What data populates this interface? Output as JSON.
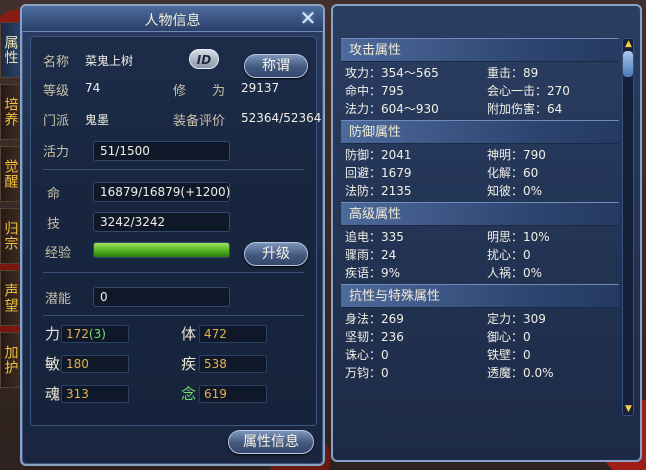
{
  "window": {
    "title": "人物信息"
  },
  "tabs": [
    "属性",
    "培养",
    "觉醒",
    "归宗",
    "声望",
    "加护"
  ],
  "character": {
    "name_label": "名称",
    "name": "菜鬼上树",
    "id_badge": "ID",
    "title_button": "称谓",
    "level_label": "等级",
    "level": "74",
    "cultivation_label": "修　　为",
    "cultivation": "29137",
    "sect_label": "门派",
    "sect": "鬼墨",
    "equip_label": "装备评价",
    "equip": "52364/52364",
    "vitality_label": "活力",
    "vitality": "51/1500",
    "hp_label": "命",
    "hp": "16879/16879(+1200)",
    "skill_label": "技",
    "skill": "3242/3242",
    "exp_label": "经验",
    "exp_fraction": 1.0,
    "levelup_button": "升级",
    "potential_label": "潜能",
    "potential": "0"
  },
  "stats": {
    "str_label": "力",
    "str": "172",
    "str_bonus": "(3)",
    "con_label": "体",
    "con": "472",
    "agi_label": "敏",
    "agi": "180",
    "spd_label": "疾",
    "spd": "538",
    "soul_label": "魂",
    "soul": "313",
    "mind_label": "念",
    "mind": "619"
  },
  "attr_info_button": "属性信息",
  "attributes": {
    "sections": [
      {
        "title": "攻击属性",
        "rows": [
          [
            "攻力：354～565",
            "重击：89"
          ],
          [
            "命中：795",
            "会心一击：270"
          ],
          [
            "法力：604～930",
            "附加伤害：64"
          ]
        ]
      },
      {
        "title": "防御属性",
        "rows": [
          [
            "防御：2041",
            "神明：790"
          ],
          [
            "回避：1679",
            "化解：60"
          ],
          [
            "法防：2135",
            "知彼：0%"
          ]
        ]
      },
      {
        "title": "高级属性",
        "rows": [
          [
            "追电：335",
            "明思：10%"
          ],
          [
            "骤雨：24",
            "扰心：0"
          ],
          [
            "疾语：9%",
            "人祸：0%"
          ]
        ]
      },
      {
        "title": "抗性与特殊属性",
        "rows": [
          [
            "身法：269",
            "定力：309"
          ],
          [
            "坚韧：236",
            "御心：0"
          ],
          [
            "诛心：0",
            "铁壁：0"
          ],
          [
            "万钧：0",
            "透魔：0.0%"
          ]
        ]
      }
    ]
  },
  "colors": {
    "panel": "#1d2c48",
    "accent": "#8aa2c4",
    "stat_value": "#e6b050",
    "bonus": "#6fe06a",
    "tab_text": "#f0c040"
  }
}
